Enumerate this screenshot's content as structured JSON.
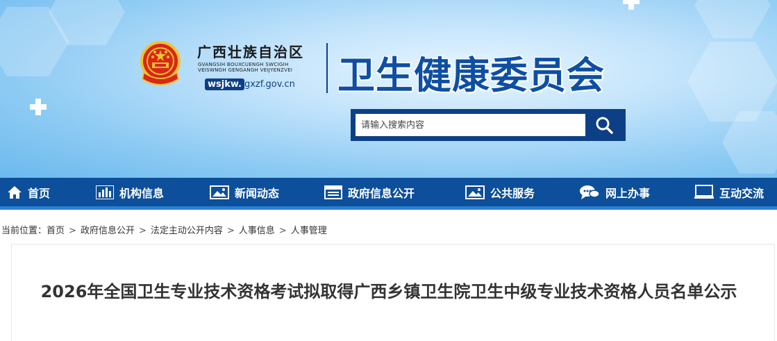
{
  "header": {
    "region_name": "广西壮族自治区",
    "region_pinyin_line1": "GVANGSIH BOUXCUENGH SWCIGIH",
    "region_pinyin_line2": "VEISWNGH GENGANGH VEIJYENZVEI",
    "domain_prefix": "wsjkw.",
    "domain_suffix": "gxzf.gov.cn",
    "committee_name": "卫生健康委员会"
  },
  "search": {
    "placeholder": "请输入搜索内容"
  },
  "nav": {
    "items": [
      {
        "label": "首页",
        "icon": "home-icon"
      },
      {
        "label": "机构信息",
        "icon": "bar-chart-icon"
      },
      {
        "label": "新闻动态",
        "icon": "image-icon"
      },
      {
        "label": "政府信息公开",
        "icon": "building-icon"
      },
      {
        "label": "公共服务",
        "icon": "image-icon"
      },
      {
        "label": "网上办事",
        "icon": "chat-icon"
      },
      {
        "label": "互动交流",
        "icon": "monitor-icon"
      }
    ]
  },
  "breadcrumb": {
    "prefix": "当前位置：",
    "items": [
      "首页",
      "政府信息公开",
      "法定主动公开内容",
      "人事信息",
      "人事管理"
    ]
  },
  "article": {
    "title": "2026年全国卫生专业技术资格考试拟取得广西乡镇卫生院卫生中级专业技术资格人员名单公示"
  },
  "colors": {
    "brand_blue": "#0d4f9a",
    "nav_underline": "#2a7fd0",
    "search_frame": "#0d3f86"
  }
}
